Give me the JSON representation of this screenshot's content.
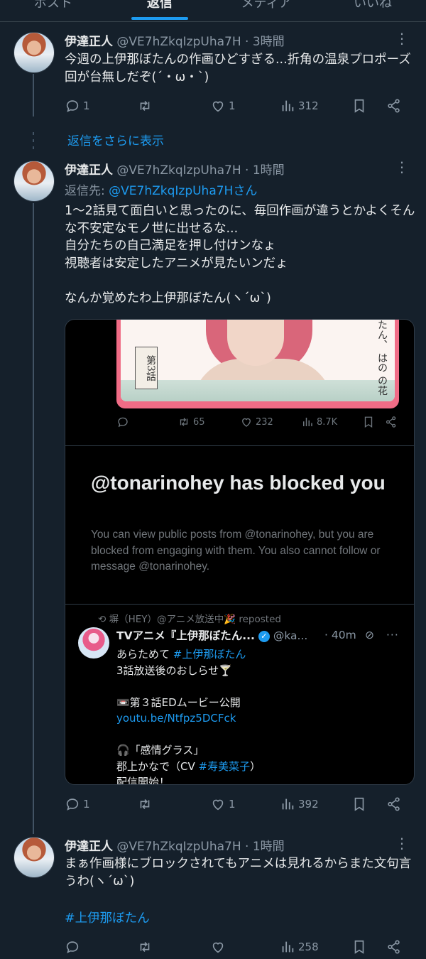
{
  "tabs": [
    {
      "label": "ポスト"
    },
    {
      "label": "返信"
    },
    {
      "label": "メディア"
    },
    {
      "label": "いいね"
    }
  ],
  "tweets": [
    {
      "name": "伊達正人",
      "handle": "@VE7hZkqIzpUha7H",
      "time": "· 3時間",
      "text": "今週の上伊那ぼたんの作画ひどすぎる...折角の温泉プロポーズ回が台無しだぞ(´・ω・`)",
      "replies": "1",
      "retweets": "",
      "likes": "1",
      "views": "312"
    },
    {
      "name": "伊達正人",
      "handle": "@VE7hZkqIzpUha7H",
      "time": "· 1時間",
      "reply_to_prefix": "返信先: ",
      "reply_to_handle": "@VE7hZkqIzpUha7H",
      "reply_to_suffix": "さん",
      "text": "1〜2話見て面白いと思ったのに、毎回作画が違うとかよくそんな不安定なモノ世に出せるな...\n自分たちの自己満足を押し付けンなょ\n視聴者は安定したアニメが見たいンだょ\n\nなんか覚めたわ上伊那ぼたん(ヽ´ω`)",
      "replies": "1",
      "retweets": "",
      "likes": "1",
      "views": "392"
    },
    {
      "name": "伊達正人",
      "handle": "@VE7hZkqIzpUha7H",
      "time": "· 1時間",
      "text": "まぁ作画様にブロックされてもアニメは見れるからまた文句言うわ(ヽ´ω`)",
      "hashtag": "#上伊那ぼたん",
      "replies": "",
      "retweets": "",
      "likes": "",
      "views": "258"
    }
  ],
  "show_more_replies": "返信をさらに表示",
  "card": {
    "art_badge": "第3話",
    "art_vertical": "たん、\nはの\nの花",
    "inner_retweets": "65",
    "inner_likes": "232",
    "inner_views": "8.7K",
    "blocked_title": "@tonarinohey has blocked you",
    "blocked_body": "You can view public posts from @tonarinohey, but you are blocked from engaging with them. You also cannot follow or message @tonarinohey.",
    "reposted_by": "塀（HEY）@アニメ放送中🎉 reposted",
    "quoted_name": "TVアニメ『上伊那ぼたん...",
    "quoted_handle": "@ka...",
    "quoted_time": "· 40m",
    "quoted_line1_prefix": "あらためて ",
    "quoted_line1_tag": "#上伊那ぼたん",
    "quoted_line2": "3話放送後のおしらせ🍸",
    "quoted_line3": "📼第３話EDムービー公開",
    "quoted_link": "youtu.be/Ntfpz5DCFck",
    "quoted_line4": "🎧「感情グラス」",
    "quoted_line5_prefix": "郡上かなで（CV ",
    "quoted_line5_tag": "#寿美菜子",
    "quoted_line5_suffix": "）",
    "quoted_line6": "配信開始！"
  },
  "colors": {
    "background": "#15202b",
    "accent": "#1d9bf0",
    "secondary_text": "#8b98a5"
  },
  "icons": [
    "reply-icon",
    "retweet-icon",
    "like-icon",
    "views-icon",
    "bookmark-icon",
    "share-icon",
    "more-icon"
  ]
}
